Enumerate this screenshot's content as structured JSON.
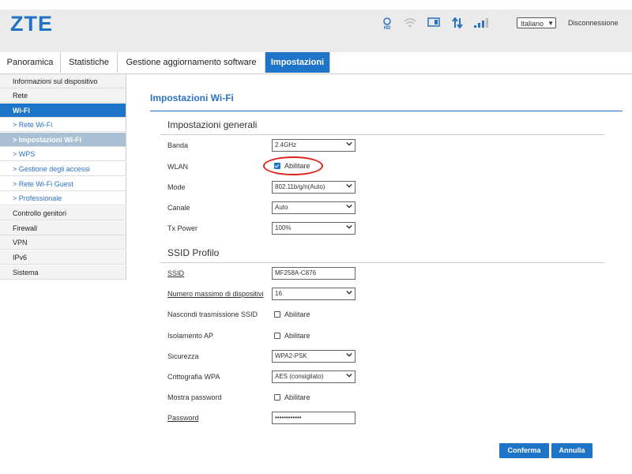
{
  "header": {
    "logo": "ZTE",
    "language": "Italiano",
    "logout": "Disconnessione",
    "status_icons": [
      "hd-voice-icon",
      "wifi-signal-icon",
      "sim-card-icon",
      "data-transfer-icon",
      "network-signal-icon"
    ],
    "hd_label": "HD"
  },
  "nav": {
    "tabs": [
      {
        "label": "Panoramica"
      },
      {
        "label": "Statistiche"
      },
      {
        "label": "Gestione aggiornamento software"
      },
      {
        "label": "Impostazioni"
      }
    ],
    "active": "Impostazioni"
  },
  "sidebar": {
    "items": [
      {
        "label": "Informazioni sul dispositivo"
      },
      {
        "label": "Rete"
      },
      {
        "label": "Wi-Fi"
      },
      {
        "label": "> Rete Wi-Fi"
      },
      {
        "label": "> Impostazioni Wi-Fi"
      },
      {
        "label": "> WPS"
      },
      {
        "label": "> Gestione degli accessi"
      },
      {
        "label": "> Rete Wi-Fi Guest"
      },
      {
        "label": "> Professionale"
      },
      {
        "label": "Controllo genitori"
      },
      {
        "label": "Firewall"
      },
      {
        "label": "VPN"
      },
      {
        "label": "IPv6"
      },
      {
        "label": "Sistema"
      }
    ]
  },
  "main": {
    "title": "Impostazioni Wi-Fi",
    "general": {
      "title": "Impostazioni generali",
      "banda_label": "Banda",
      "banda_value": "2.4GHz",
      "wlan_label": "WLAN",
      "wlan_check": "Abilitare",
      "mode_label": "Mode",
      "mode_value": "802.11b/g/n(Auto)",
      "canale_label": "Canale",
      "canale_value": "Auto",
      "txpower_label": "Tx Power",
      "txpower_value": "100%"
    },
    "ssid": {
      "title": "SSID Profilo",
      "ssid_label": "SSID",
      "ssid_value": "MF258A-C876",
      "maxdev_label": "Numero massimo di dispositivi",
      "maxdev_value": "16",
      "hide_label": "Nascondi trasmissione SSID",
      "hide_check": "Abilitare",
      "iso_label": "Isolamento AP",
      "iso_check": "Abilitare",
      "sec_label": "Sicurezza",
      "sec_value": "WPA2-PSK",
      "wpa_label": "Crittografia WPA",
      "wpa_value": "AES (consigliato)",
      "showpw_label": "Mostra password",
      "showpw_check": "Abilitare",
      "pw_label": "Password",
      "pw_value": "••••••••••••"
    },
    "buttons": {
      "confirm": "Conferma",
      "cancel": "Annulla"
    }
  },
  "colors": {
    "accent": "#1e74c6",
    "highlight": "#e0201b"
  }
}
